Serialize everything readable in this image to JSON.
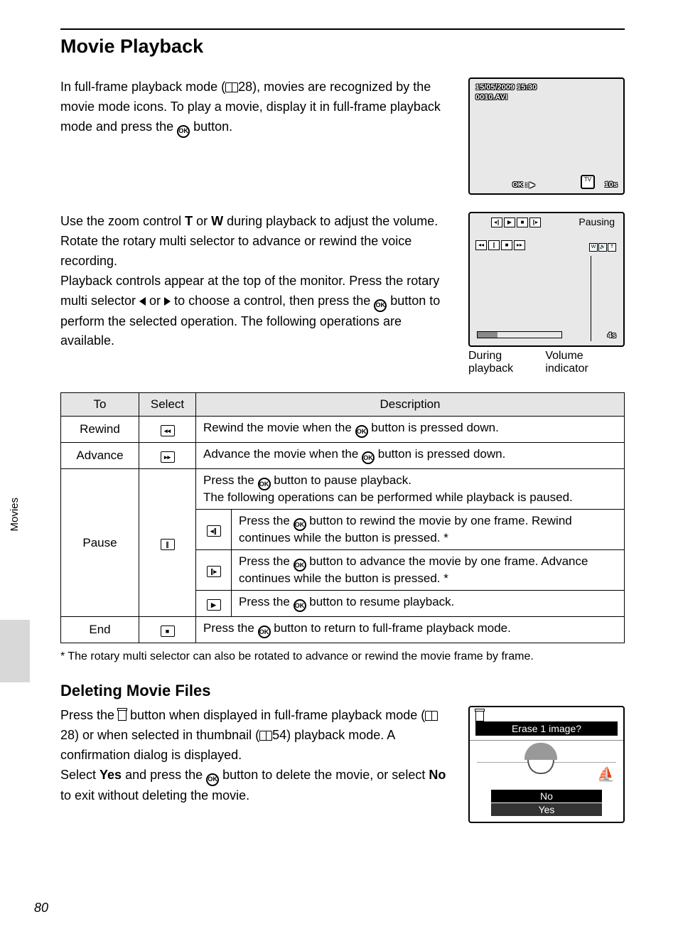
{
  "pageNumber": "80",
  "sideTab": "Movies",
  "heading": "Movie Playback",
  "para1a": "In full-frame playback mode (",
  "para1b": "28), movies are recognized by the movie mode icons. To play a movie, display it in full-frame playback mode and press the ",
  "para1c": " button.",
  "para2a": "Use the zoom control ",
  "para2T": "T",
  "para2or": " or ",
  "para2W": "W",
  "para2b": " during playback to adjust the volume.",
  "para3": "Rotate the rotary multi selector to advance or rewind the voice recording.",
  "para4a": "Playback controls appear at the top of the monitor. Press the rotary multi selector ",
  "para4b": " or ",
  "para4c": " to choose a control, then press the ",
  "para4d": " button to perform the selected operation. The following operations are available.",
  "screen1": {
    "date": "15/05/2009 15:30",
    "file": "0010.AVI",
    "time": "10s"
  },
  "screen2": {
    "pausing": "Pausing",
    "time": "4s",
    "cap1": "During playback",
    "cap2": "Volume indicator"
  },
  "table": {
    "h1": "To",
    "h2": "Select",
    "h3": "Description",
    "r1": {
      "to": "Rewind",
      "desc_a": "Rewind the movie when the ",
      "desc_b": " button is pressed down."
    },
    "r2": {
      "to": "Advance",
      "desc_a": "Advance the movie when the ",
      "desc_b": " button is pressed down."
    },
    "r3": {
      "to": "Pause",
      "main_a": "Press the ",
      "main_b": " button to pause playback.",
      "main_c": "The following operations can be performed while playback is paused.",
      "s1_a": "Press the ",
      "s1_b": " button to rewind the movie by one frame. Rewind continues while the button is pressed. *",
      "s2_a": "Press the ",
      "s2_b": " button to advance the movie by one frame. Advance continues while the button is pressed. *",
      "s3_a": "Press the ",
      "s3_b": " button to resume playback."
    },
    "r4": {
      "to": "End",
      "desc_a": "Press the ",
      "desc_b": " button to return to full-frame playback mode."
    }
  },
  "footnote": "*  The rotary multi selector can also be rotated to advance or rewind the movie frame by frame.",
  "heading2": "Deleting Movie Files",
  "del1a": "Press the ",
  "del1b": " button when displayed in full-frame playback mode (",
  "del1c": "28) or when selected in thumbnail (",
  "del1d": "54) playback mode. A confirmation dialog is displayed.",
  "del2a": "Select ",
  "del2yes": "Yes",
  "del2b": " and press the ",
  "del2c": " button to delete the movie, or select ",
  "del2no": "No",
  "del2d": " to exit without deleting the movie.",
  "delScreen": {
    "q": "Erase 1 image?",
    "no": "No",
    "yes": "Yes"
  }
}
